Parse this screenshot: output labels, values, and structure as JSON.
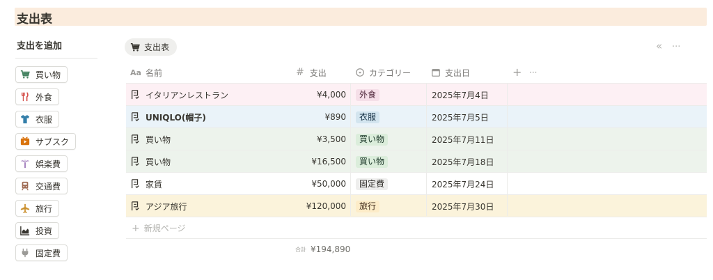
{
  "page": {
    "title": "支出表"
  },
  "sidebar": {
    "heading": "支出を追加",
    "buttons": [
      {
        "label": "買い物",
        "icon": "shopping-cart-icon",
        "color": "#448361"
      },
      {
        "label": "外食",
        "icon": "fork-knife-icon",
        "color": "#d44c47"
      },
      {
        "label": "衣服",
        "icon": "tshirt-icon",
        "color": "#337ea9"
      },
      {
        "label": "サブスク",
        "icon": "play-box-icon",
        "color": "#d9730d"
      },
      {
        "label": "娯楽費",
        "icon": "palm-tree-icon",
        "color": "#9065b0"
      },
      {
        "label": "交通費",
        "icon": "train-icon",
        "color": "#9f6b53"
      },
      {
        "label": "旅行",
        "icon": "airplane-icon",
        "color": "#cb912f"
      },
      {
        "label": "投資",
        "icon": "chart-icon",
        "color": "#37352f"
      },
      {
        "label": "固定費",
        "icon": "plug-icon",
        "color": "#9b9a97"
      }
    ]
  },
  "view": {
    "tab_label": "支出表",
    "collapse_symbol": "«",
    "more_symbol": "···"
  },
  "table": {
    "columns": [
      {
        "label": "名前",
        "icon_text": "Aa"
      },
      {
        "label": "支出",
        "icon_text": "#"
      },
      {
        "label": "カテゴリー",
        "icon": "select-icon"
      },
      {
        "label": "支出日",
        "icon": "calendar-icon"
      }
    ],
    "add_symbol": "+",
    "more_symbol": "···",
    "rows": [
      {
        "name": "イタリアンレストラン",
        "amount": "¥4,000",
        "category": "外食",
        "date": "2025年7月4日",
        "row_bg": "#fdf0f4",
        "tag_bg": "#f5dfe8",
        "tag_fg": "#4c2337"
      },
      {
        "name": "UNIQLO(帽子)",
        "amount": "¥890",
        "category": "衣服",
        "date": "2025年7月5日",
        "row_bg": "#eaf3f9",
        "tag_bg": "#d3e5ef",
        "tag_fg": "#183347"
      },
      {
        "name": "買い物",
        "amount": "¥3,500",
        "category": "買い物",
        "date": "2025年7月11日",
        "row_bg": "#edf3ec",
        "tag_bg": "#dbeddb",
        "tag_fg": "#1c3829"
      },
      {
        "name": "買い物",
        "amount": "¥16,500",
        "category": "買い物",
        "date": "2025年7月18日",
        "row_bg": "#edf3ec",
        "tag_bg": "#dbeddb",
        "tag_fg": "#1c3829"
      },
      {
        "name": "家賃",
        "amount": "¥50,000",
        "category": "固定費",
        "date": "2025年7月24日",
        "row_bg": "#ffffff",
        "tag_bg": "#eeeeed",
        "tag_fg": "#32302c"
      },
      {
        "name": "アジア旅行",
        "amount": "¥120,000",
        "category": "旅行",
        "date": "2025年7月30日",
        "row_bg": "#fbf3db",
        "tag_bg": "#fdecc8",
        "tag_fg": "#402c1b"
      }
    ],
    "new_page_label": "新規ページ",
    "new_page_symbol": "+",
    "sum_label": "合計",
    "sum_value": "¥194,890"
  }
}
